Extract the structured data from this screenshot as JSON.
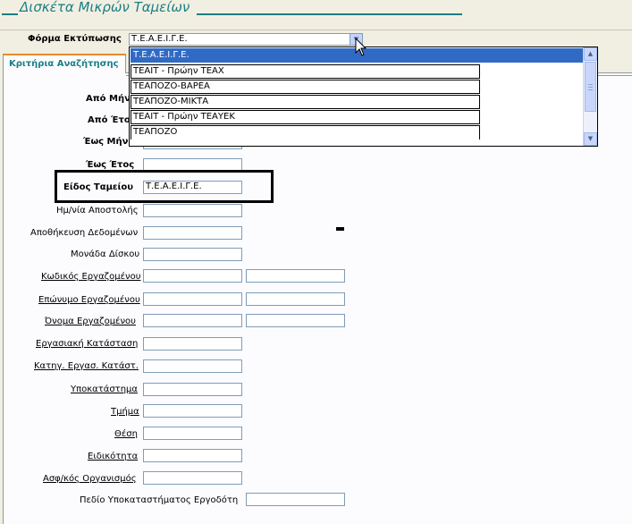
{
  "window": {
    "title": "Δισκέτα Μικρών Ταμείων"
  },
  "print_form": {
    "label": "Φόρμα Εκτύπωσης",
    "value": "Τ.Ε.Α.Ε.Ι.Γ.Ε.",
    "options": [
      "Τ.Ε.Α.Ε.Ι.Γ.Ε.",
      "ΤΕΑΙΤ - Πρώην ΤΕΑΧ",
      "ΤΕΑΠΟΖΟ-ΒΑΡΕΑ",
      "ΤΕΑΠΟΖΟ-ΜΙΚΤΑ",
      "ΤΕΑΙΤ - Πρώην ΤΕΑΥΕΚ",
      "ΤΕΑΠΟΖΟ"
    ],
    "selected_index": 0
  },
  "tab": {
    "label": "Κριτήρια Αναζήτησης"
  },
  "fields": {
    "from_month": {
      "label": "Από Μήν",
      "value": ""
    },
    "from_year": {
      "label": "Από Έτο",
      "value": ""
    },
    "to_month": {
      "label": "Έως Μήν",
      "value": ""
    },
    "to_year": {
      "label": "Έως Έτος",
      "value": ""
    },
    "fund_type": {
      "label": "Είδος Ταμείου",
      "value": "Τ.Ε.Α.Ε.Ι.Γ.Ε."
    },
    "send_date": {
      "label": "Ημ/νία Αποστολής",
      "value": ""
    },
    "data_storage": {
      "label": "Αποθήκευση Δεδομένων",
      "value": ""
    },
    "disk_unit": {
      "label": "Μονάδα Δίσκου",
      "value": ""
    },
    "employee_code": {
      "label": "Κωδικός Εργαζομένου",
      "value_from": "",
      "value_to": ""
    },
    "employee_surname": {
      "label": "Επώνυμο Εργαζομένου",
      "value_from": "",
      "value_to": ""
    },
    "employee_name": {
      "label": "Όνομα Εργαζομένου",
      "value_from": "",
      "value_to": ""
    },
    "employment_status": {
      "label": "Εργασιακή Κατάσταση",
      "value": ""
    },
    "employment_status_category": {
      "label": "Κατηγ. Εργασ. Κατάστ.",
      "value": ""
    },
    "branch": {
      "label": "Υποκατάστημα",
      "value": ""
    },
    "department": {
      "label": "Τμήμα",
      "value": ""
    },
    "position": {
      "label": "Θέση",
      "value": ""
    },
    "specialty": {
      "label": "Ειδικότητα",
      "value": ""
    },
    "insurance_org": {
      "label": "Ασφ/κός Οργανισμός",
      "value": ""
    },
    "employer_branch_field": {
      "label": "Πεδίο Υποκαταστήματος Εργοδότη",
      "value": ""
    }
  },
  "icons": {
    "combo_arrow": "chevron-down-icon",
    "scroll_up": "arrow-up-icon",
    "scroll_down": "arrow-down-icon",
    "cursor": "mouse-pointer-icon"
  },
  "colors": {
    "accent": "#1a7f86",
    "selection": "#316ac5",
    "tab_highlight": "#e68b2c"
  }
}
